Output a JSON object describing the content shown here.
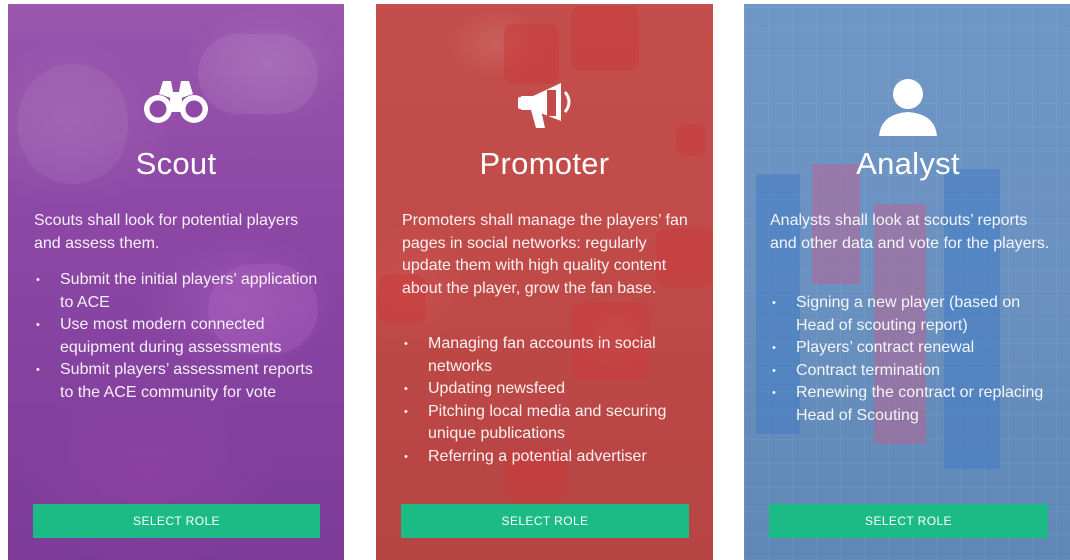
{
  "cards": [
    {
      "id": "scout",
      "icon": "binoculars-icon",
      "title": "Scout",
      "description": "Scouts shall look for potential players and assess them.",
      "bullets": [
        "Submit the initial players’ application to ACE",
        "Use most modern connected equipment during assessments",
        "Submit players’ assessment reports to the ACE community for vote"
      ],
      "button_label": "SELECT ROLE"
    },
    {
      "id": "promoter",
      "icon": "megaphone-icon",
      "title": "Promoter",
      "description": "Promoters shall manage the players’ fan pages in social networks: regularly update them with high quality content about the player, grow the fan base.",
      "bullets": [
        "Managing fan accounts in social networks",
        "Updating newsfeed",
        "Pitching local media and securing unique publications",
        "Referring a potential advertiser"
      ],
      "button_label": "SELECT ROLE"
    },
    {
      "id": "analyst",
      "icon": "user-icon",
      "title": "Analyst",
      "description": "Analysts shall look at scouts’ reports and other data and vote for the players.",
      "bullets": [
        "Signing a new player (based on Head of scouting report)",
        "Players’ contract renewal",
        "Contract termination",
        "Renewing the contract or replacing Head of Scouting"
      ],
      "button_label": "SELECT ROLE"
    }
  ],
  "colors": {
    "scout": "#8c47a5",
    "promoter": "#c14c49",
    "analyst": "#6a91c0",
    "button": "#1cbb85"
  }
}
